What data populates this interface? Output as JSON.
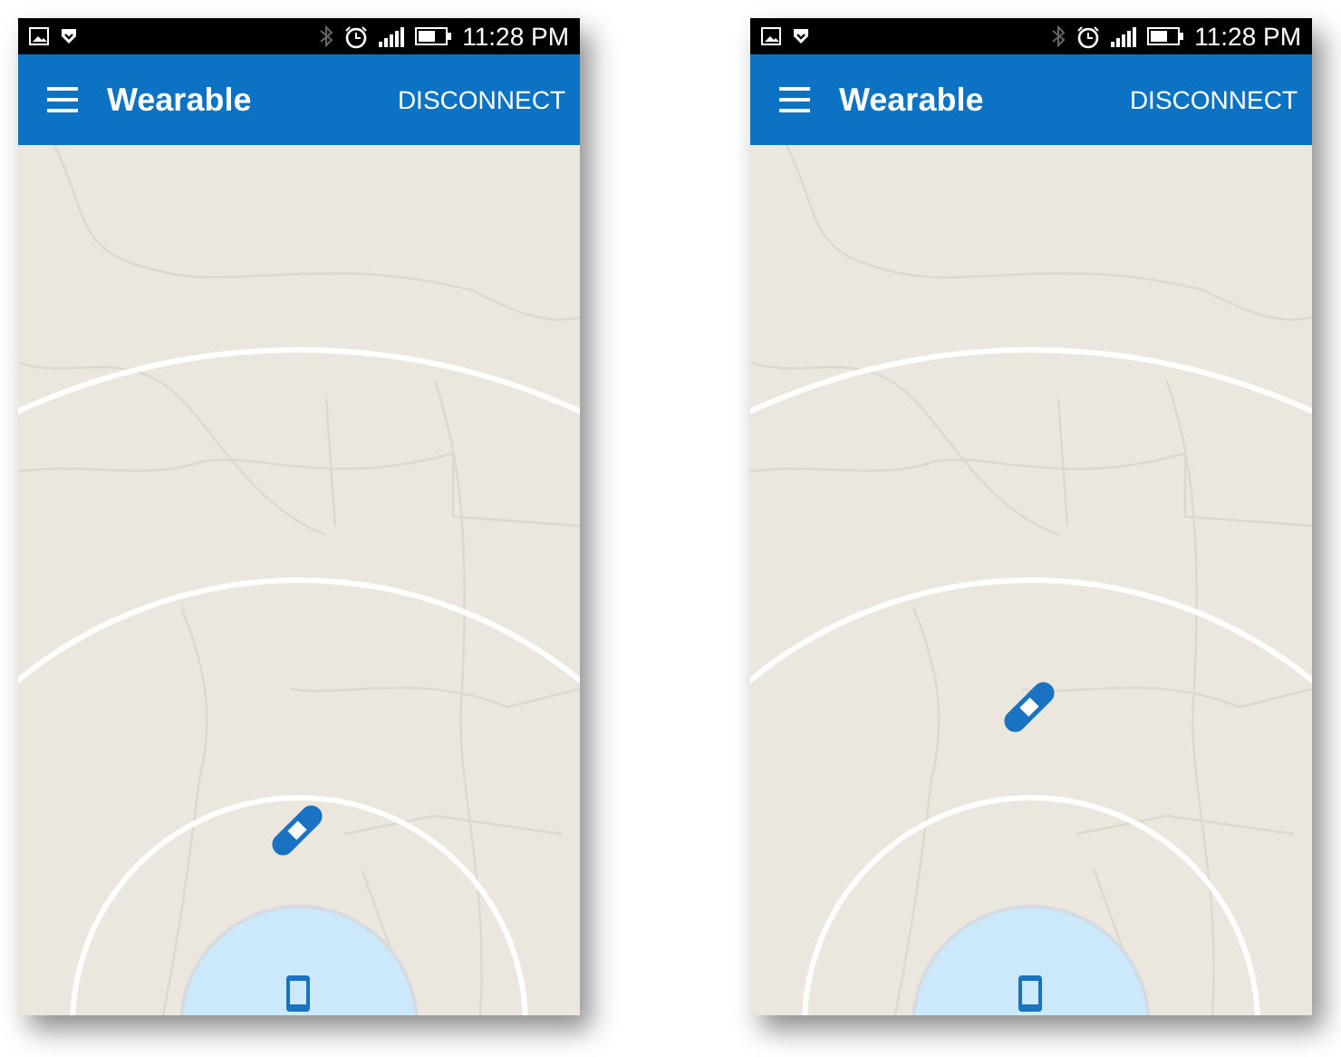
{
  "phones": [
    {
      "status_bar": {
        "time": "11:28 PM"
      },
      "app_bar": {
        "title": "Wearable",
        "action": "DISCONNECT"
      },
      "wearable_marker": {
        "kind": "inner"
      }
    },
    {
      "status_bar": {
        "time": "11:28 PM"
      },
      "app_bar": {
        "title": "Wearable",
        "action": "DISCONNECT"
      },
      "wearable_marker": {
        "kind": "middle"
      }
    }
  ]
}
